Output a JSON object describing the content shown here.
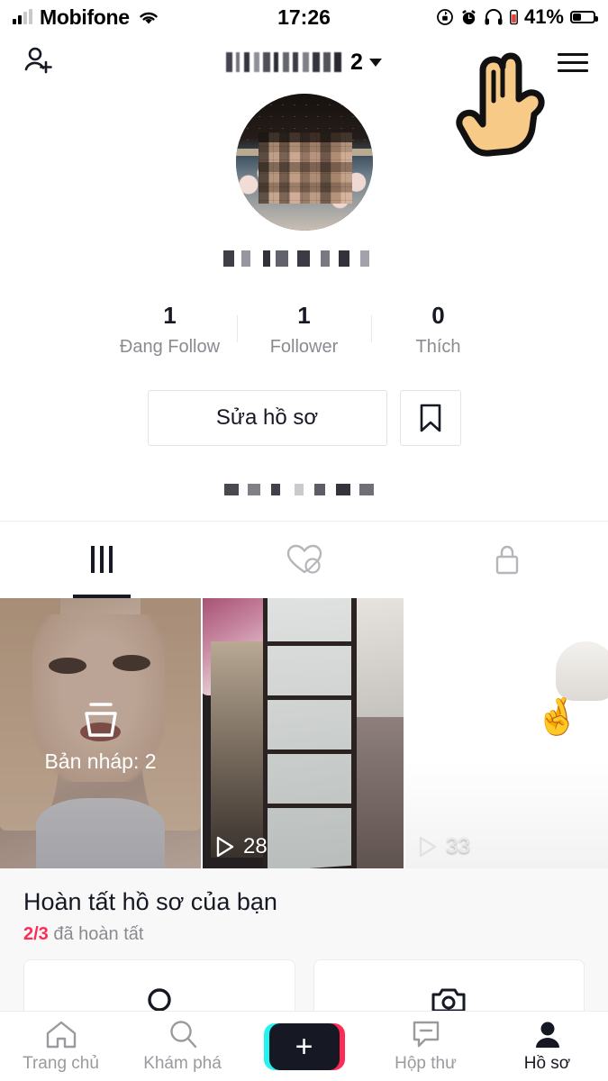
{
  "status_bar": {
    "carrier": "Mobifone",
    "time": "17:26",
    "battery_percent": "41%",
    "icons": [
      "signal-bars-icon",
      "wifi-icon",
      "rotation-lock-icon",
      "alarm-icon",
      "headphones-icon",
      "battery-icon"
    ]
  },
  "header": {
    "add_friend_icon": "add-person-icon",
    "username_suffix": "2",
    "username_blurred": true,
    "dropdown_icon": "chevron-down-icon",
    "menu_icon": "hamburger-menu-icon",
    "pointer_overlay": "pointing-hand-cursor"
  },
  "profile": {
    "avatar_icon": "avatar-image",
    "display_name_blurred": true,
    "stats": [
      {
        "value": "1",
        "label": "Đang Follow"
      },
      {
        "value": "1",
        "label": "Follower"
      },
      {
        "value": "0",
        "label": "Thích"
      }
    ],
    "edit_button": "Sửa hồ sơ",
    "bookmark_icon": "bookmark-icon",
    "bio_blurred": true
  },
  "tabs": [
    {
      "name": "videos-tab",
      "icon": "grid-icon",
      "active": true
    },
    {
      "name": "liked-tab",
      "icon": "heart-hidden-icon",
      "active": false
    },
    {
      "name": "private-tab",
      "icon": "lock-icon",
      "active": false
    }
  ],
  "videos": [
    {
      "name": "drafts-tile",
      "draft_icon": "drafts-icon",
      "label": "Bản nháp: 2",
      "is_draft": true
    },
    {
      "name": "video-tile-2",
      "views": "28",
      "play_icon": "play-icon"
    },
    {
      "name": "video-tile-3",
      "views": "33",
      "play_icon": "play-icon"
    }
  ],
  "complete_profile": {
    "title": "Hoàn tất hồ sơ của bạn",
    "progress": "2/3",
    "progress_suffix": "đã hoàn tất",
    "cards": [
      {
        "name": "add-avatar-card",
        "icon": "circle-person-icon"
      },
      {
        "name": "add-video-card",
        "icon": "camera-icon"
      }
    ]
  },
  "bottom_nav": [
    {
      "name": "nav-home",
      "label": "Trang chủ",
      "icon": "home-icon",
      "active": false
    },
    {
      "name": "nav-discover",
      "label": "Khám phá",
      "icon": "search-icon",
      "active": false
    },
    {
      "name": "nav-create",
      "label": "",
      "icon": "plus-icon",
      "active": false
    },
    {
      "name": "nav-inbox",
      "label": "Hộp thư",
      "icon": "inbox-icon",
      "active": false
    },
    {
      "name": "nav-profile",
      "label": "Hồ sơ",
      "icon": "person-filled-icon",
      "active": true
    }
  ],
  "colors": {
    "accent_pink": "#FE2C55",
    "accent_cyan": "#25F4EE",
    "text_primary": "#161823",
    "text_muted": "#8A8B91"
  }
}
